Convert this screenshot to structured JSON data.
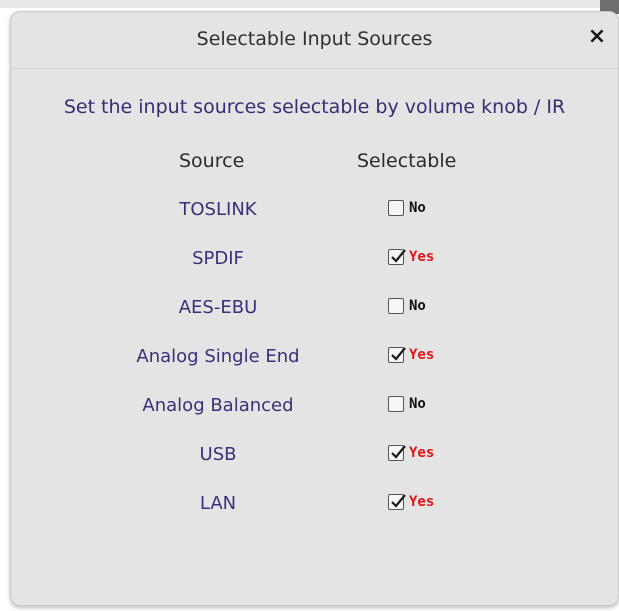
{
  "dialog": {
    "title": "Selectable Input Sources",
    "close_label": "×",
    "description": "Set the input sources selectable by volume knob / IR"
  },
  "table": {
    "headers": {
      "source": "Source",
      "selectable": "Selectable"
    },
    "rows": [
      {
        "source": "TOSLINK",
        "checked": false,
        "state": "No"
      },
      {
        "source": "SPDIF",
        "checked": true,
        "state": "Yes"
      },
      {
        "source": "AES-EBU",
        "checked": false,
        "state": "No"
      },
      {
        "source": "Analog Single End",
        "checked": true,
        "state": "Yes"
      },
      {
        "source": "Analog Balanced",
        "checked": false,
        "state": "No"
      },
      {
        "source": "USB",
        "checked": true,
        "state": "Yes"
      },
      {
        "source": "LAN",
        "checked": true,
        "state": "Yes"
      }
    ]
  },
  "colors": {
    "dialog_bg": "#e4e4e4",
    "label_purple": "#3f2d7a",
    "yes_red": "#e31414",
    "no_black": "#111111"
  }
}
